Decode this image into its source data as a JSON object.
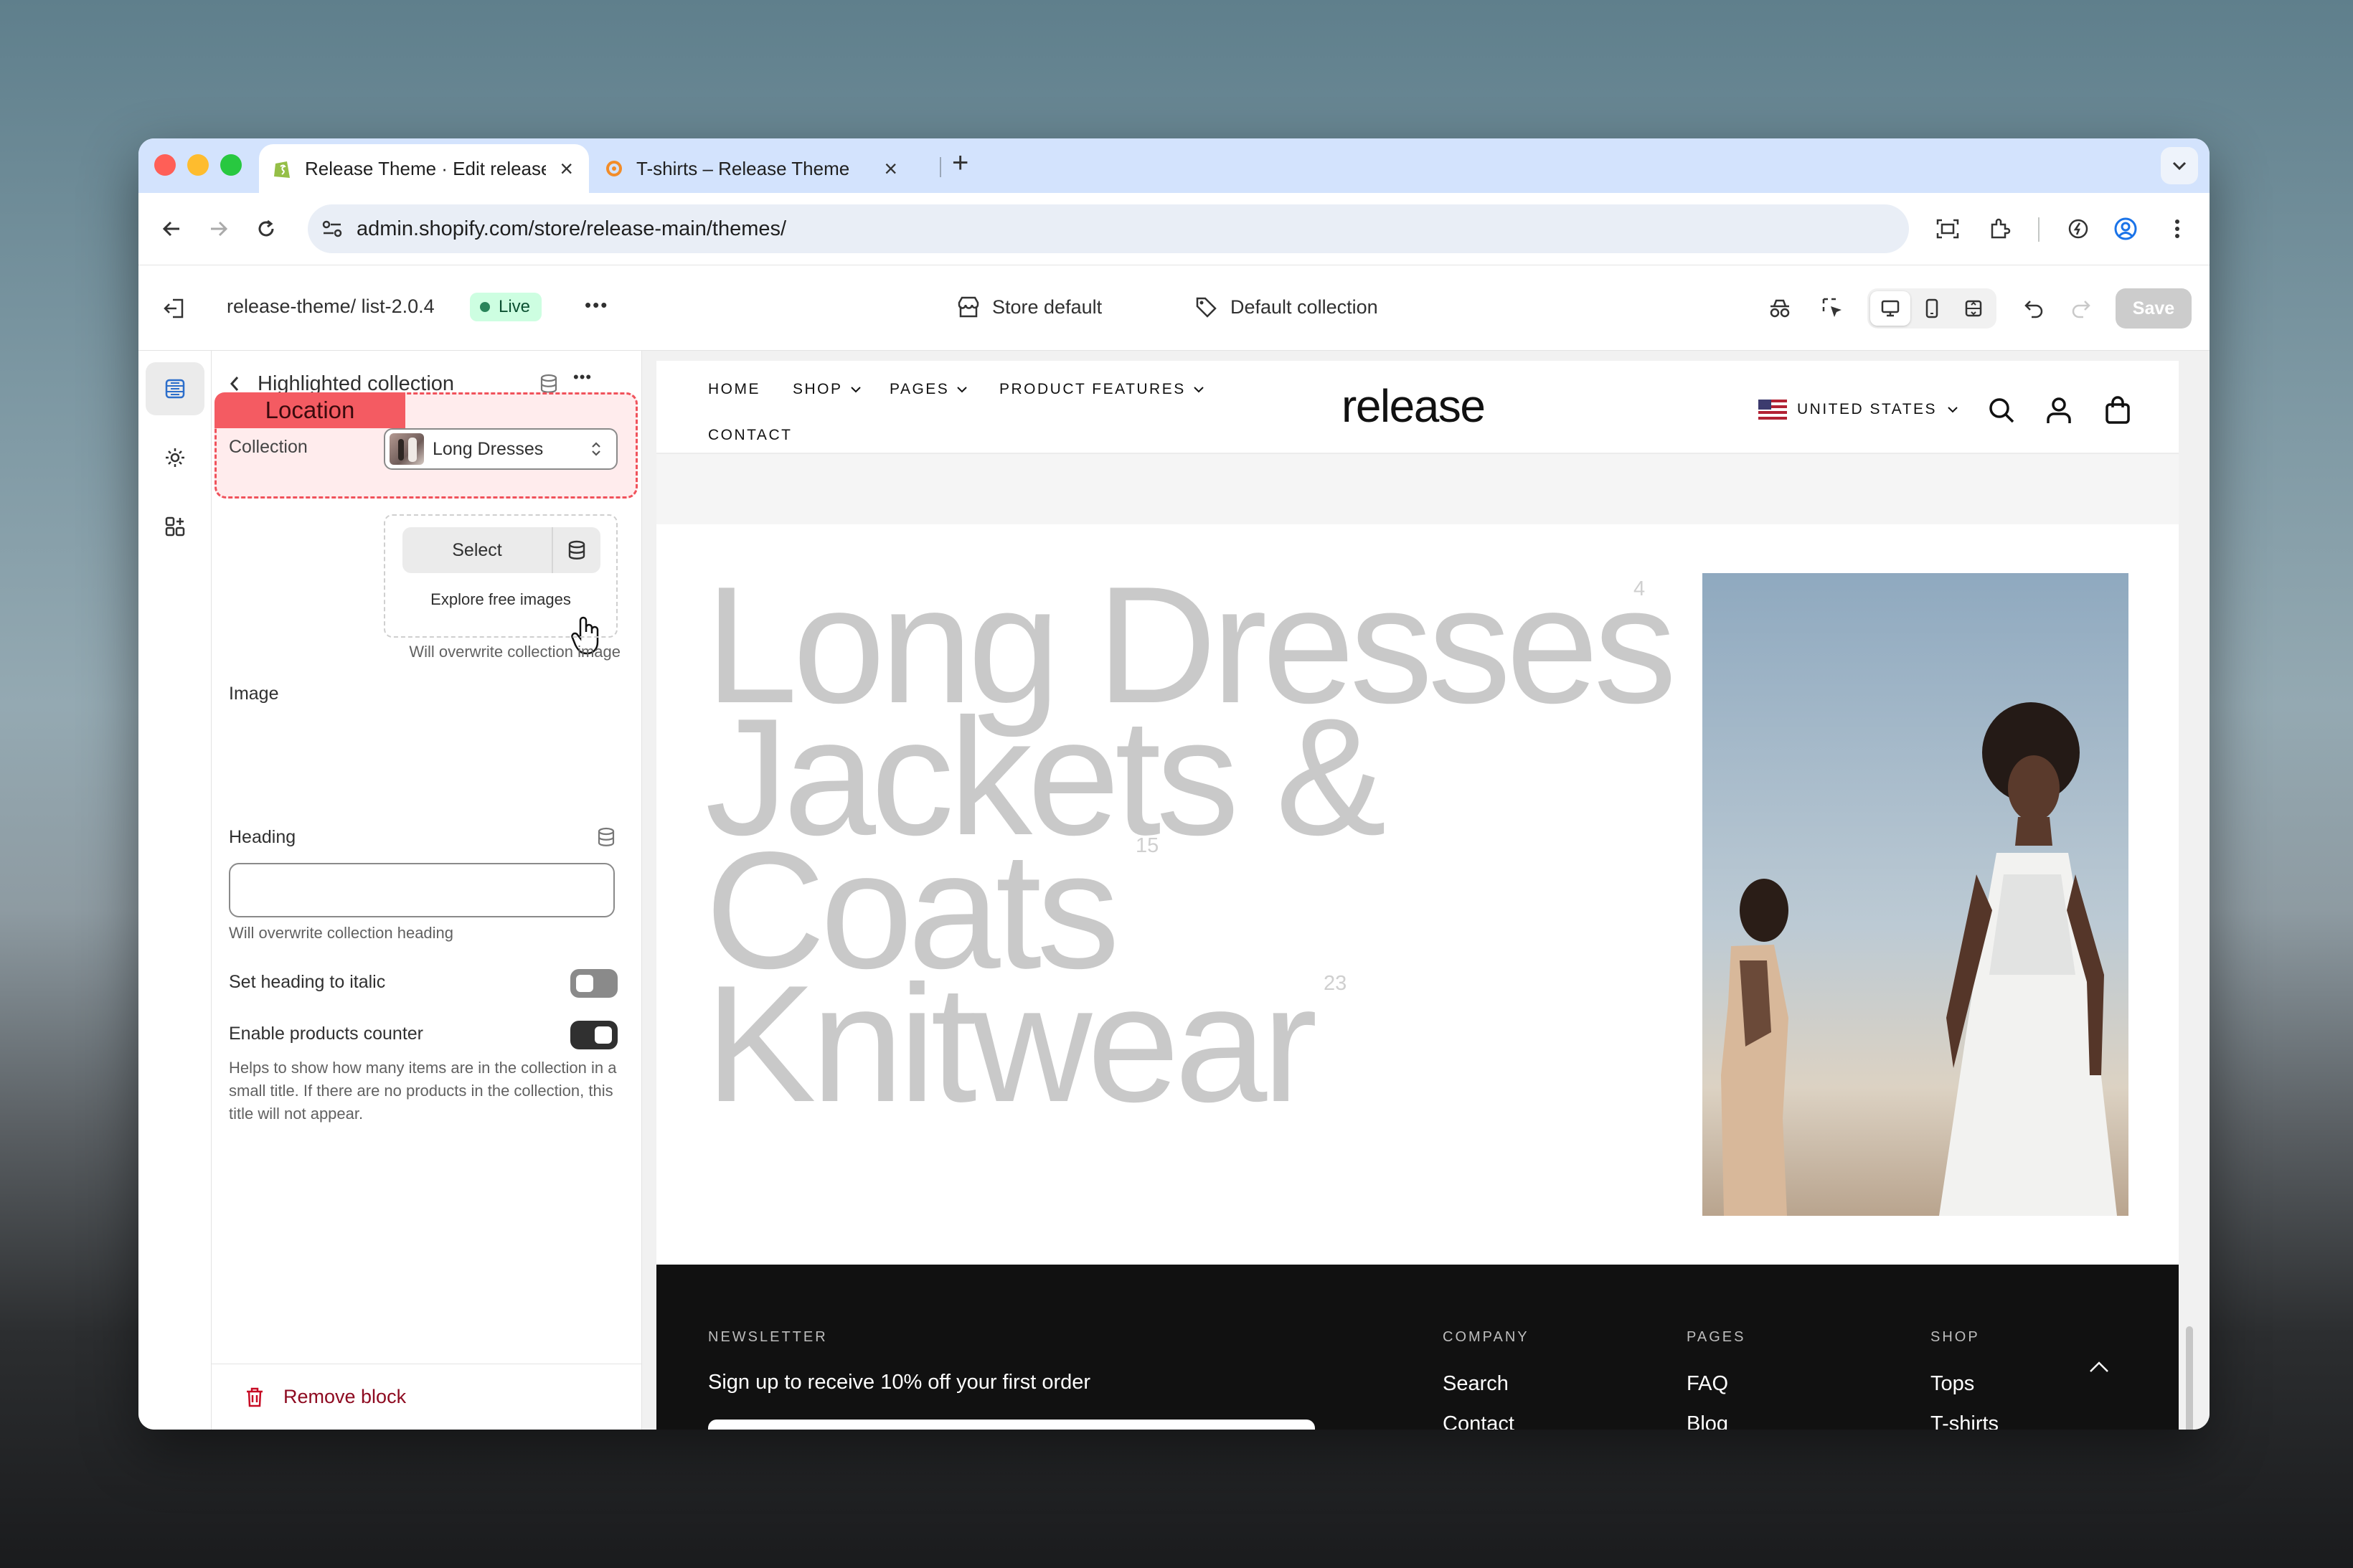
{
  "browser": {
    "tabs": [
      {
        "title": "Release Theme · Edit release",
        "active": true
      },
      {
        "title": "T-shirts – Release Theme",
        "active": false
      }
    ],
    "new_tab": "+",
    "url": "admin.shopify.com/store/release-main/themes/"
  },
  "editor": {
    "theme_name": "release-theme/ list-2.0.4",
    "live_badge": "Live",
    "more": "•••",
    "store_default": "Store default",
    "default_collection": "Default collection",
    "save": "Save"
  },
  "panel": {
    "title": "Highlighted collection",
    "more": "•••",
    "location_tag": "Location",
    "collection_label": "Collection",
    "collection_value": "Long Dresses",
    "image_label": "Image",
    "select_button": "Select",
    "explore_images": "Explore free images",
    "image_help": "Will overwrite collection image",
    "heading_label": "Heading",
    "heading_value": "",
    "heading_help": "Will overwrite collection heading",
    "italic_label": "Set heading to italic",
    "italic_on": false,
    "counter_label": "Enable products counter",
    "counter_on": true,
    "counter_help": "Helps to show how many items are in the collection in a small title. If there are no products in the collection, this title will not appear.",
    "remove_block": "Remove block"
  },
  "store": {
    "nav": [
      "HOME",
      "SHOP",
      "PAGES",
      "PRODUCT FEATURES",
      "CONTACT"
    ],
    "brand": "release",
    "country": "UNITED STATES",
    "collections": [
      {
        "name": "Long Dresses",
        "count": "4"
      },
      {
        "name": "Jackets &",
        "count": ""
      },
      {
        "name": "Coats",
        "count": "15"
      },
      {
        "name": "Knitwear",
        "count": "23"
      }
    ],
    "footer": {
      "newsletter_heading": "NEWSLETTER",
      "newsletter_text": "Sign up to receive 10% off your first order",
      "columns": [
        {
          "heading": "COMPANY",
          "links": [
            "Search",
            "Contact"
          ]
        },
        {
          "heading": "PAGES",
          "links": [
            "FAQ",
            "Blog"
          ]
        },
        {
          "heading": "SHOP",
          "links": [
            "Tops",
            "T-shirts"
          ]
        }
      ]
    }
  },
  "colors": {
    "tabbar": "#d3e3fd",
    "live_bg": "#cdfee1",
    "highlight": "#f45b62",
    "remove": "#8e0b21"
  }
}
